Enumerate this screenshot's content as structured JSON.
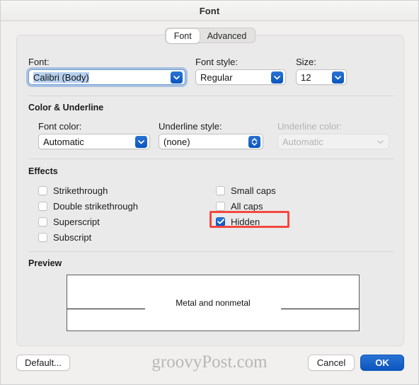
{
  "window": {
    "title": "Font"
  },
  "tabs": [
    {
      "label": "Font",
      "selected": true
    },
    {
      "label": "Advanced",
      "selected": false
    }
  ],
  "font_section": {
    "font_label": "Font:",
    "font_value": "Calibri (Body)",
    "font_style_label": "Font style:",
    "font_style_value": "Regular",
    "size_label": "Size:",
    "size_value": "12"
  },
  "color_underline_section": {
    "title": "Color & Underline",
    "font_color_label": "Font color:",
    "font_color_value": "Automatic",
    "underline_style_label": "Underline style:",
    "underline_style_value": "(none)",
    "underline_color_label": "Underline color:",
    "underline_color_value": "Automatic"
  },
  "effects_section": {
    "title": "Effects",
    "left_column": [
      {
        "label": "Strikethrough",
        "checked": false
      },
      {
        "label": "Double strikethrough",
        "checked": false
      },
      {
        "label": "Superscript",
        "checked": false
      },
      {
        "label": "Subscript",
        "checked": false
      }
    ],
    "right_column": [
      {
        "label": "Small caps",
        "checked": false
      },
      {
        "label": "All caps",
        "checked": false
      },
      {
        "label": "Hidden",
        "checked": true,
        "highlighted": true
      }
    ]
  },
  "preview_section": {
    "title": "Preview",
    "sample_text": "Metal and nonmetal"
  },
  "footer": {
    "default_label": "Default...",
    "cancel_label": "Cancel",
    "ok_label": "OK",
    "watermark": "groovyPost.com"
  },
  "colors": {
    "accent": "#0b55bd",
    "highlight": "#f4483f",
    "window_bg": "#f1f0ef",
    "panel_bg": "#eaeaea"
  }
}
